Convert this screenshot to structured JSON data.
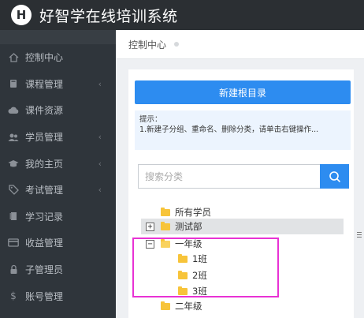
{
  "header": {
    "logo_letter": "H",
    "title": "好智学在线培训系统"
  },
  "sidebar": {
    "items": [
      {
        "label": "控制中心",
        "icon": "home-icon",
        "has_arrow": false
      },
      {
        "label": "课程管理",
        "icon": "book-icon",
        "has_arrow": true
      },
      {
        "label": "课件资源",
        "icon": "cloud-icon",
        "has_arrow": false
      },
      {
        "label": "学员管理",
        "icon": "users-icon",
        "has_arrow": true
      },
      {
        "label": "我的主页",
        "icon": "graduation-cap-icon",
        "has_arrow": true
      },
      {
        "label": "考试管理",
        "icon": "tag-icon",
        "has_arrow": true
      },
      {
        "label": "学习记录",
        "icon": "notebook-icon",
        "has_arrow": false
      },
      {
        "label": "收益管理",
        "icon": "credit-card-icon",
        "has_arrow": false
      },
      {
        "label": "子管理员",
        "icon": "lock-icon",
        "has_arrow": false
      },
      {
        "label": "账号管理",
        "icon": "dollar-icon",
        "has_arrow": false
      }
    ]
  },
  "breadcrumb": {
    "label": "控制中心"
  },
  "panel": {
    "new_root_label": "新建根目录",
    "tip_title": "提示：",
    "tip_text": "1.新建子分组、重命名、删除分类，请单击右键操作..."
  },
  "search": {
    "placeholder": "搜索分类"
  },
  "tree": {
    "nodes": [
      {
        "label": "所有学员",
        "level": 0,
        "toggle": ""
      },
      {
        "label": "测试部",
        "level": 0,
        "toggle": "+"
      },
      {
        "label": "一年级",
        "level": 0,
        "toggle": "−"
      },
      {
        "label": "1班",
        "level": 1,
        "toggle": ""
      },
      {
        "label": "2班",
        "level": 1,
        "toggle": ""
      },
      {
        "label": "3班",
        "level": 1,
        "toggle": ""
      },
      {
        "label": "二年级",
        "level": 0,
        "toggle": ""
      }
    ]
  },
  "colors": {
    "accent": "#2d8cf0",
    "topbar": "#2b2f33",
    "sidebar": "#2f353b",
    "annotation": "#e832d4",
    "folder": "#f7c43a"
  }
}
